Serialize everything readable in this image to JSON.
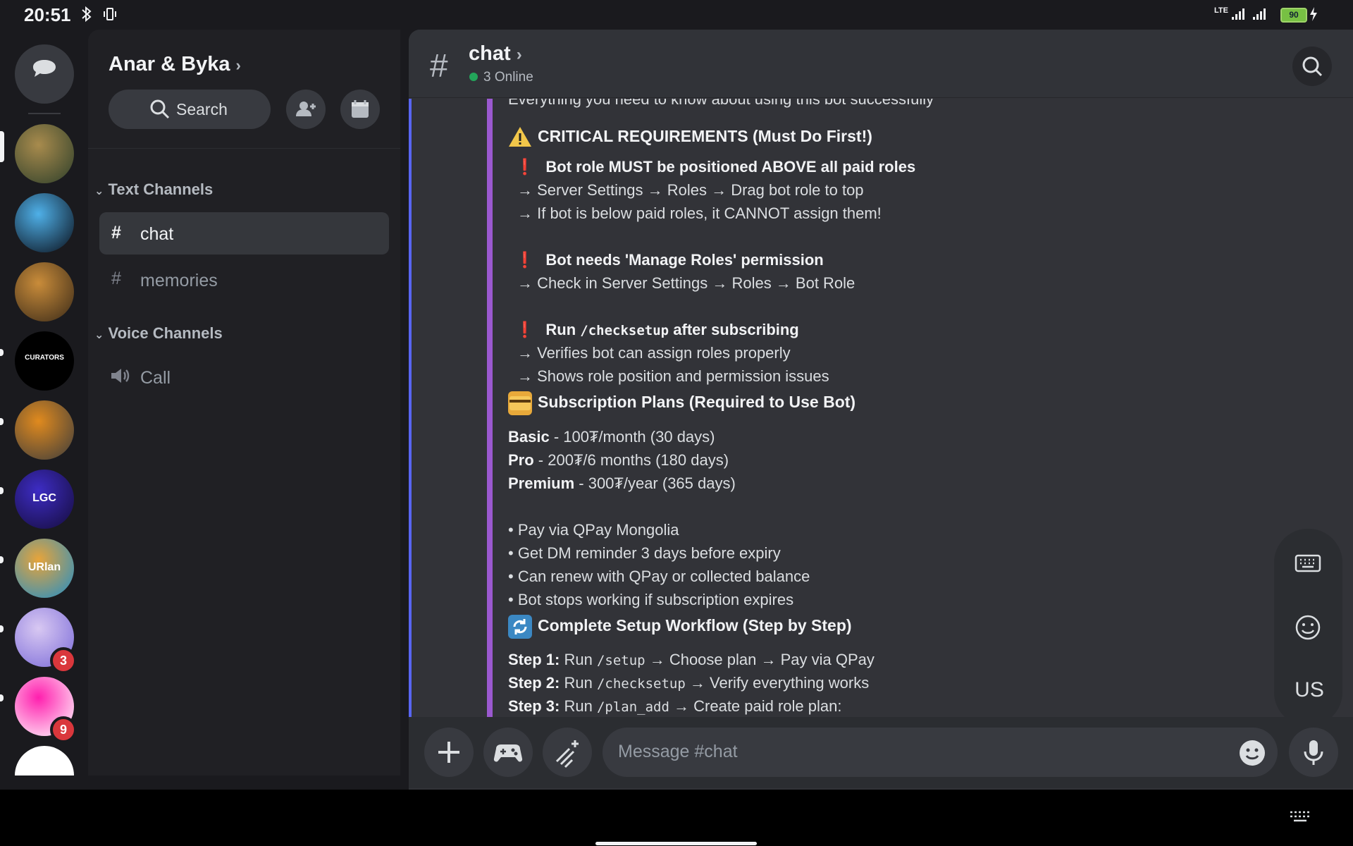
{
  "status_bar": {
    "time": "20:51",
    "signal": "LTE",
    "battery": "90"
  },
  "rail": {
    "servers": [
      {
        "name": "gazebo-server",
        "colors": [
          "#2d3f2a",
          "#a88b4d"
        ]
      },
      {
        "name": "orbs-server",
        "colors": [
          "#0a0f1a",
          "#4fb0e8"
        ]
      },
      {
        "name": "house-server",
        "colors": [
          "#3a2a18",
          "#c98c3a"
        ]
      },
      {
        "name": "curators-server",
        "label": "CURATORS",
        "colors": [
          "#000000",
          "#000000"
        ]
      },
      {
        "name": "knight-server",
        "colors": [
          "#3c3c3c",
          "#e08a1e"
        ]
      },
      {
        "name": "lgc-server",
        "label": "LGC",
        "colors": [
          "#150c3a",
          "#3d2cc4"
        ]
      },
      {
        "name": "urlan-server",
        "label": "URlan",
        "colors": [
          "#1f8ec9",
          "#e7a43a"
        ]
      },
      {
        "name": "anime-server",
        "badge": "3",
        "colors": [
          "#7a6ad8",
          "#d8c8f2"
        ]
      },
      {
        "name": "pink-x-server",
        "badge": "9",
        "colors": [
          "#ffffff",
          "#ff1fae"
        ]
      }
    ]
  },
  "sidebar": {
    "server_name": "Anar & Byka",
    "search_label": "Search",
    "categories": {
      "text": "Text Channels",
      "voice": "Voice Channels"
    },
    "channels": {
      "chat": "chat",
      "memories": "memories",
      "call": "Call"
    }
  },
  "header": {
    "channel": "chat",
    "online": "3 Online"
  },
  "embed": {
    "intro": "Everything you need to know about using this bot successfully",
    "critical_title": "CRITICAL REQUIREMENTS (Must Do First!)",
    "req1": "Bot role MUST be positioned ABOVE all paid roles",
    "req1_a": "→ Server Settings → Roles → Drag bot role to top",
    "req1_b": "→ If bot is below paid roles, it CANNOT assign them!",
    "req2": "Bot needs 'Manage Roles' permission",
    "req2_a": "→ Check in Server Settings → Roles → Bot Role",
    "req3_pre": "Run",
    "req3_cmd": "/checksetup",
    "req3_post": "after subscribing",
    "req3_a": "→ Verifies bot can assign roles properly",
    "req3_b": "→ Shows role position and permission issues",
    "plans_title": "Subscription Plans (Required to Use Bot)",
    "plans": [
      {
        "name": "Basic",
        "detail": " - 100₮/month (30 days)"
      },
      {
        "name": "Pro",
        "detail": " - 200₮/6 months (180 days)"
      },
      {
        "name": "Premium",
        "detail": " - 300₮/year (365 days)"
      }
    ],
    "bullets": [
      "• Pay via QPay Mongolia",
      "• Get DM reminder 3 days before expiry",
      "• Can renew with QPay or collected balance",
      "• Bot stops working if subscription expires"
    ],
    "workflow_title": "Complete Setup Workflow (Step by Step)",
    "steps": [
      {
        "label": "Step 1:",
        "pre": " Run ",
        "cmd": "/setup",
        "post": " → Choose plan → Pay via QPay"
      },
      {
        "label": "Step 2:",
        "pre": " Run ",
        "cmd": "/checksetup",
        "post": " → Verify everything works"
      },
      {
        "label": "Step 3:",
        "pre": " Run ",
        "cmd": "/plan_add",
        "post": " → Create paid role plan:"
      }
    ]
  },
  "composer": {
    "placeholder": "Message #chat"
  },
  "keyboard_panel": {
    "lang": "US"
  },
  "colors": {
    "accent_purple": "#9b59d0",
    "online_green": "#23a55a",
    "badge_red": "#da373c"
  }
}
